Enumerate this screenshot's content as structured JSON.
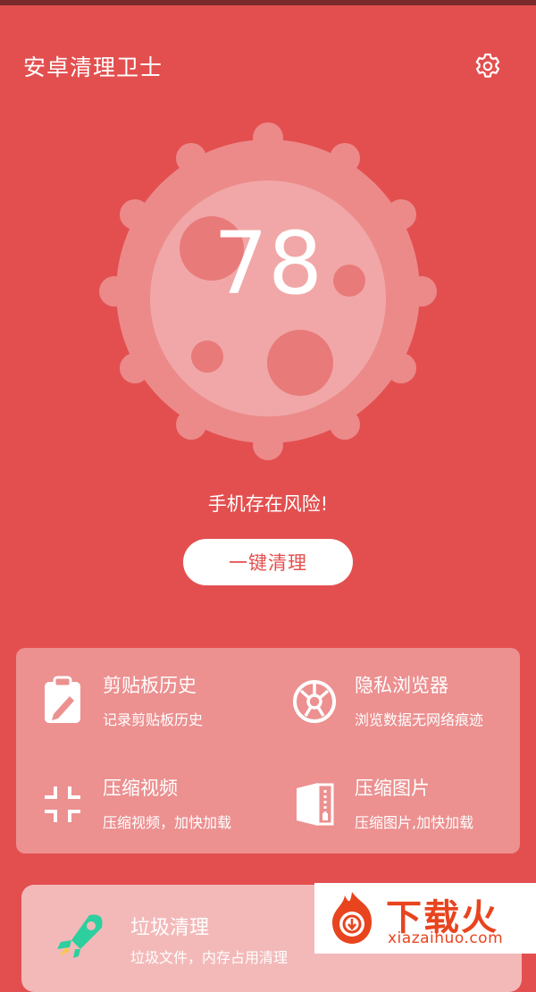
{
  "header": {
    "title": "安卓清理卫士",
    "settings_icon": "gear-icon"
  },
  "score": {
    "value": "78"
  },
  "status": {
    "message": "手机存在风险!"
  },
  "action": {
    "clean_label": "一键清理"
  },
  "tools": [
    {
      "title": "剪贴板历史",
      "subtitle": "记录剪贴板历史",
      "icon": "clipboard-icon"
    },
    {
      "title": "隐私浏览器",
      "subtitle": "浏览数据无网络痕迹",
      "icon": "browser-icon"
    },
    {
      "title": "压缩视频",
      "subtitle": "压缩视频，加快加载",
      "icon": "compress-icon"
    },
    {
      "title": "压缩图片",
      "subtitle": "压缩图片,加快加载",
      "icon": "image-zip-icon"
    }
  ],
  "junk": {
    "title": "垃圾清理",
    "subtitle": "垃圾文件，内存占用清理",
    "icon": "rocket-icon"
  },
  "watermark": {
    "brand": "下载火",
    "domain": "xiazaihuo.com"
  },
  "colors": {
    "background": "#e34f4f",
    "card": "#ec9090",
    "accent": "#e8441e"
  }
}
